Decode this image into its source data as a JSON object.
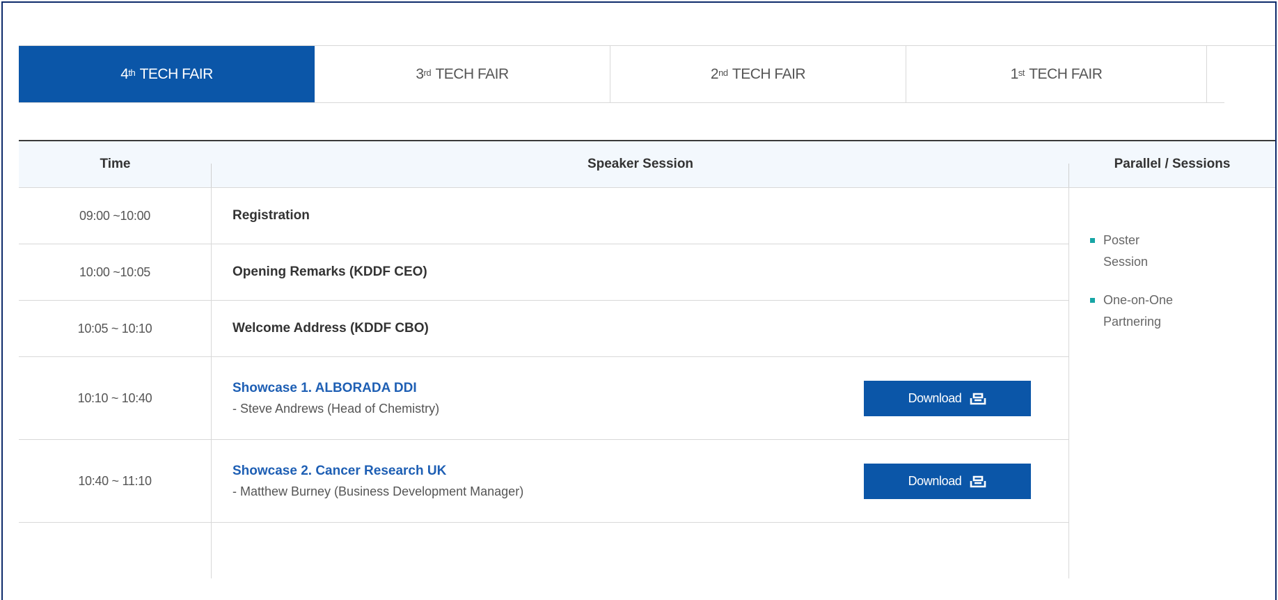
{
  "tabs": [
    {
      "num": "4",
      "suffix": "th",
      "label": "TECH FAIR",
      "active": true
    },
    {
      "num": "3",
      "suffix": "rd",
      "label": "TECH FAIR",
      "active": false
    },
    {
      "num": "2",
      "suffix": "nd",
      "label": "TECH FAIR",
      "active": false
    },
    {
      "num": "1",
      "suffix": "st",
      "label": "TECH FAIR",
      "active": false
    }
  ],
  "table": {
    "headers": {
      "time": "Time",
      "speaker": "Speaker Session",
      "parallel": "Parallel / Sessions"
    },
    "rows": [
      {
        "time": "09:00 ~10:00",
        "title": "Registration"
      },
      {
        "time": "10:00 ~10:05",
        "title": "Opening Remarks (KDDF CEO)"
      },
      {
        "time": "10:05 ~ 10:10",
        "title": "Welcome Address (KDDF CBO)"
      },
      {
        "time": "10:10 ~ 10:40",
        "title": "Showcase 1. ALBORADA DDI",
        "subtitle": "- Steve Andrews (Head of Chemistry)",
        "button": "Download"
      },
      {
        "time": "10:40 ~ 11:10",
        "title": "Showcase 2. Cancer Research UK",
        "subtitle": "- Matthew Burney (Business Development Manager)",
        "button": "Download"
      },
      {
        "time": "",
        "title": ""
      }
    ],
    "parallel_items": [
      {
        "line1": "Poster",
        "line2": "Session"
      },
      {
        "line1": "One-on-One",
        "line2": "Partnering"
      }
    ]
  },
  "colors": {
    "accent": "#0b56a8",
    "link": "#1e5fb4",
    "bullet": "#17a5a5"
  },
  "icons": {
    "download": "download-icon"
  }
}
